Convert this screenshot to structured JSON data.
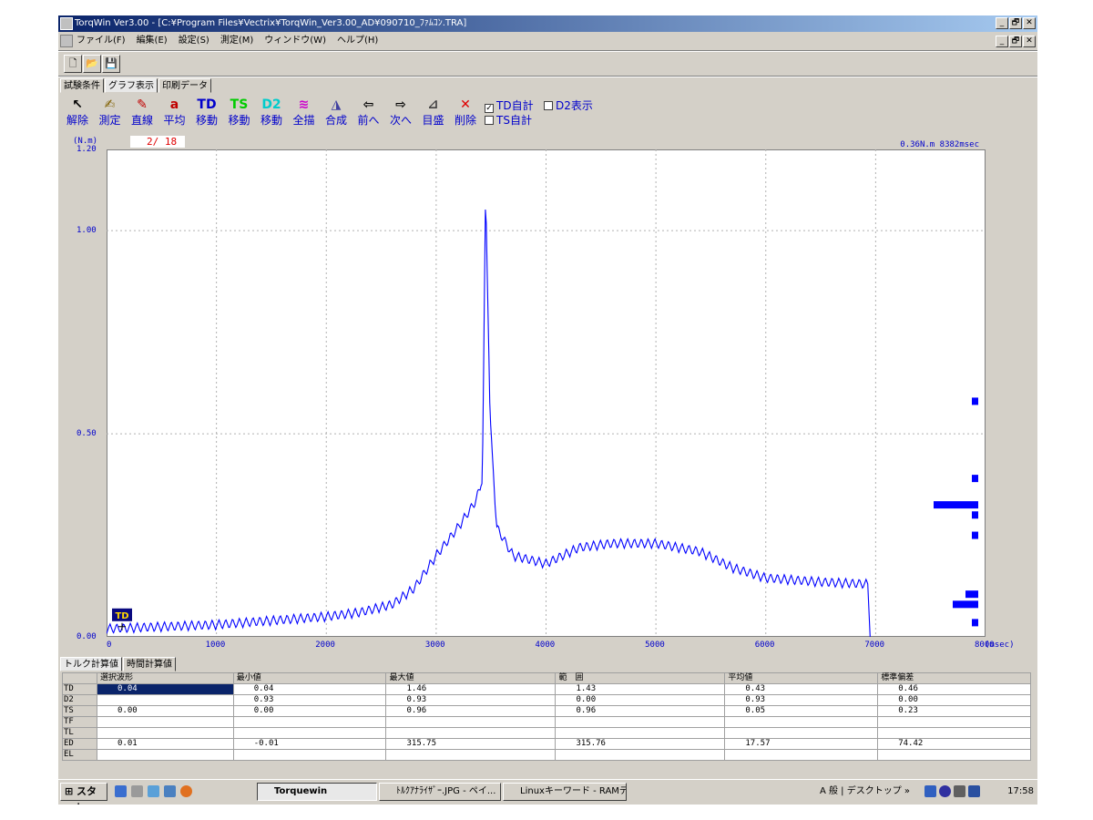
{
  "window": {
    "title": "TorqWin Ver3.00 - [C:¥Program Files¥Vectrix¥TorqWin_Ver3.00_AD¥090710_ﾌｧﾑｺﾝ.TRA]",
    "controls": [
      "_",
      "🗗",
      "✕"
    ]
  },
  "menu": [
    "ファイル(F)",
    "編集(E)",
    "設定(S)",
    "測定(M)",
    "ウィンドウ(W)",
    "ヘルプ(H)"
  ],
  "toolbar": [
    {
      "name": "new-file-button",
      "glyph": "🗋"
    },
    {
      "name": "open-file-button",
      "glyph": "📂"
    },
    {
      "name": "save-file-button",
      "glyph": "💾"
    }
  ],
  "tabs": [
    "試験条件",
    "グラフ表示",
    "印刷データ"
  ],
  "active_tab": "グラフ表示",
  "graph_tools": [
    {
      "id": "release",
      "glyph": "↖",
      "color": "#000000",
      "label": "解除"
    },
    {
      "id": "measure",
      "glyph": "✍",
      "color": "#806000",
      "label": "測定"
    },
    {
      "id": "line",
      "glyph": "✎",
      "color": "#c00000",
      "label": "直線"
    },
    {
      "id": "average",
      "glyph": "a",
      "color": "#c00000",
      "label": "平均"
    },
    {
      "id": "td-move",
      "glyph": "TD",
      "color": "#0000cc",
      "label": "移動"
    },
    {
      "id": "ts-move",
      "glyph": "TS",
      "color": "#00cc00",
      "label": "移動"
    },
    {
      "id": "d2-move",
      "glyph": "D2",
      "color": "#00cccc",
      "label": "移動"
    },
    {
      "id": "draw-all",
      "glyph": "≋",
      "color": "#cc00cc",
      "label": "全描"
    },
    {
      "id": "compose",
      "glyph": "◮",
      "color": "#4040a0",
      "label": "合成"
    },
    {
      "id": "prev",
      "glyph": "⇦",
      "color": "#000000",
      "label": "前へ"
    },
    {
      "id": "next",
      "glyph": "⇨",
      "color": "#000000",
      "label": "次へ"
    },
    {
      "id": "scale",
      "glyph": "⊿",
      "color": "#404040",
      "label": "目盛"
    },
    {
      "id": "delete",
      "glyph": "✕",
      "color": "#e00000",
      "label": "削除"
    }
  ],
  "checkboxes": [
    {
      "label": "TD自計",
      "checked": true
    },
    {
      "label": "D2表示",
      "checked": false
    },
    {
      "label": "TS自計",
      "checked": false
    }
  ],
  "counter": "2/ 18",
  "readout": "0.36N.m  8382msec",
  "marker_label": "TD",
  "chart_data": {
    "type": "line",
    "ylabel": "(N.m)",
    "xlabel": "(msec)",
    "xlim": [
      0,
      8000
    ],
    "ylim": [
      0,
      1.2
    ],
    "x_ticks": [
      0,
      1000,
      2000,
      3000,
      4000,
      5000,
      6000,
      7000,
      8000
    ],
    "y_ticks": [
      "0.00",
      "0.50",
      "1.00",
      "1.20"
    ],
    "grid": true,
    "series": [
      {
        "color": "#0000ff",
        "envelope": [
          [
            0,
            0.02
          ],
          [
            500,
            0.025
          ],
          [
            1000,
            0.03
          ],
          [
            1500,
            0.04
          ],
          [
            2000,
            0.05
          ],
          [
            2300,
            0.06
          ],
          [
            2600,
            0.08
          ],
          [
            2800,
            0.12
          ],
          [
            3000,
            0.2
          ],
          [
            3200,
            0.27
          ],
          [
            3350,
            0.33
          ],
          [
            3420,
            0.38
          ],
          [
            3450,
            1.1
          ],
          [
            3490,
            0.55
          ],
          [
            3550,
            0.27
          ],
          [
            3700,
            0.2
          ],
          [
            4000,
            0.18
          ],
          [
            4300,
            0.22
          ],
          [
            4600,
            0.23
          ],
          [
            5000,
            0.23
          ],
          [
            5400,
            0.21
          ],
          [
            5700,
            0.17
          ],
          [
            6000,
            0.145
          ],
          [
            6500,
            0.135
          ],
          [
            6930,
            0.13
          ],
          [
            6950,
            0.0
          ]
        ],
        "ripple_amplitude": 0.012,
        "ripple_period_msec": 62
      }
    ],
    "histogram_side": [
      {
        "y": 0.58,
        "length": 1
      },
      {
        "y": 0.39,
        "length": 1
      },
      {
        "y": 0.325,
        "length": 7
      },
      {
        "y": 0.3,
        "length": 1
      },
      {
        "y": 0.25,
        "length": 1
      },
      {
        "y": 0.105,
        "length": 2
      },
      {
        "y": 0.08,
        "length": 4
      },
      {
        "y": 0.035,
        "length": 1
      }
    ]
  },
  "bottom_tabs": [
    "トルク計算値",
    "時間計算値"
  ],
  "table": {
    "headers": [
      "",
      "選択波形",
      "最小値",
      "最大値",
      "範　囲",
      "平均値",
      "標準偏差"
    ],
    "rows": [
      [
        "TD",
        "0.04",
        "0.04",
        "1.46",
        "1.43",
        "0.43",
        "0.46"
      ],
      [
        "D2",
        "",
        "0.93",
        "0.93",
        "0.00",
        "0.93",
        "0.00"
      ],
      [
        "TS",
        "0.00",
        "0.00",
        "0.96",
        "0.96",
        "0.05",
        "0.23"
      ],
      [
        "TF",
        "",
        "",
        "",
        "",
        "",
        ""
      ],
      [
        "TL",
        "",
        "",
        "",
        "",
        "",
        ""
      ],
      [
        "ED",
        "0.01",
        "-0.01",
        "315.75",
        "315.76",
        "17.57",
        "74.42"
      ],
      [
        "EL",
        "",
        "",
        "",
        "",
        "",
        ""
      ]
    ]
  },
  "taskbar": {
    "start": "スタート",
    "tasks": [
      "Torquewin",
      "ﾄﾙｸｱﾅﾗｲｻﾞｰ.JPG - ペイ...",
      "Linuxキーワード - RAMデ..."
    ],
    "tray_text": "A 般 | デスクトップ »",
    "clock": "17:58"
  }
}
